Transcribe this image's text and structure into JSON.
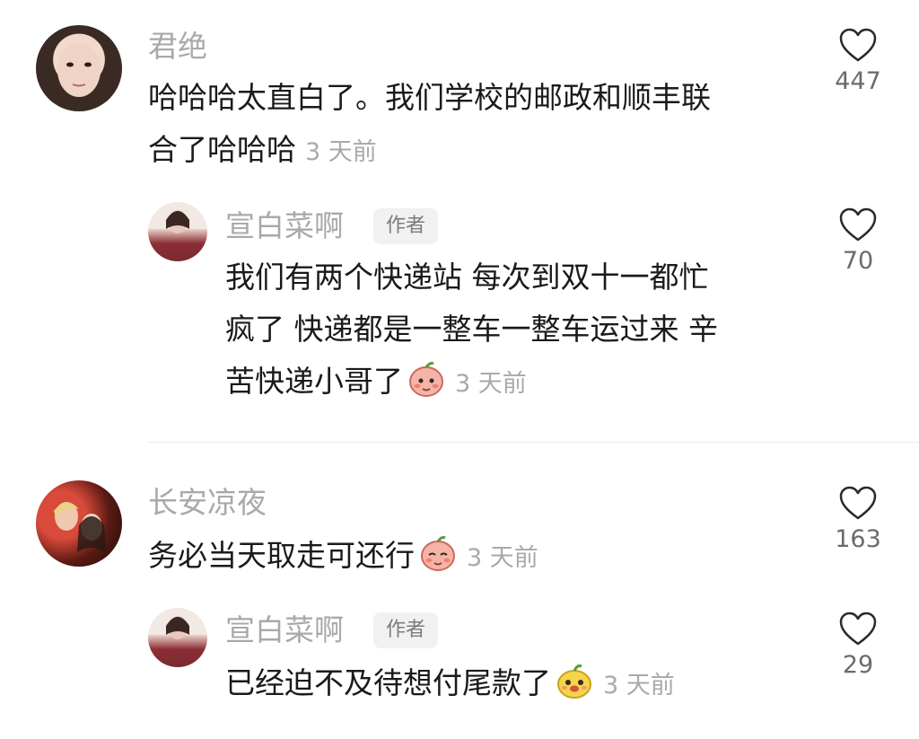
{
  "comments": [
    {
      "user": "君绝",
      "text_line1": "哈哈哈太直白了。我们学校的邮政和顺丰联",
      "text_line2": "合了哈哈哈",
      "time": "3 天前",
      "likes": "447"
    },
    {
      "user": "宣白菜啊",
      "badge": "作者",
      "text_line1": "我们有两个快递站 每次到双十一都忙",
      "text_line2": "疯了 快递都是一整车一整车运过来 辛",
      "text_line3": "苦快递小哥了",
      "time": "3 天前",
      "likes": "70"
    },
    {
      "user": "长安凉夜",
      "text_line1": "务必当天取走可还行",
      "time": "3 天前",
      "likes": "163"
    },
    {
      "user": "宣白菜啊",
      "badge": "作者",
      "text_line1": "已经迫不及待想付尾款了",
      "time": "3 天前",
      "likes": "29"
    }
  ]
}
